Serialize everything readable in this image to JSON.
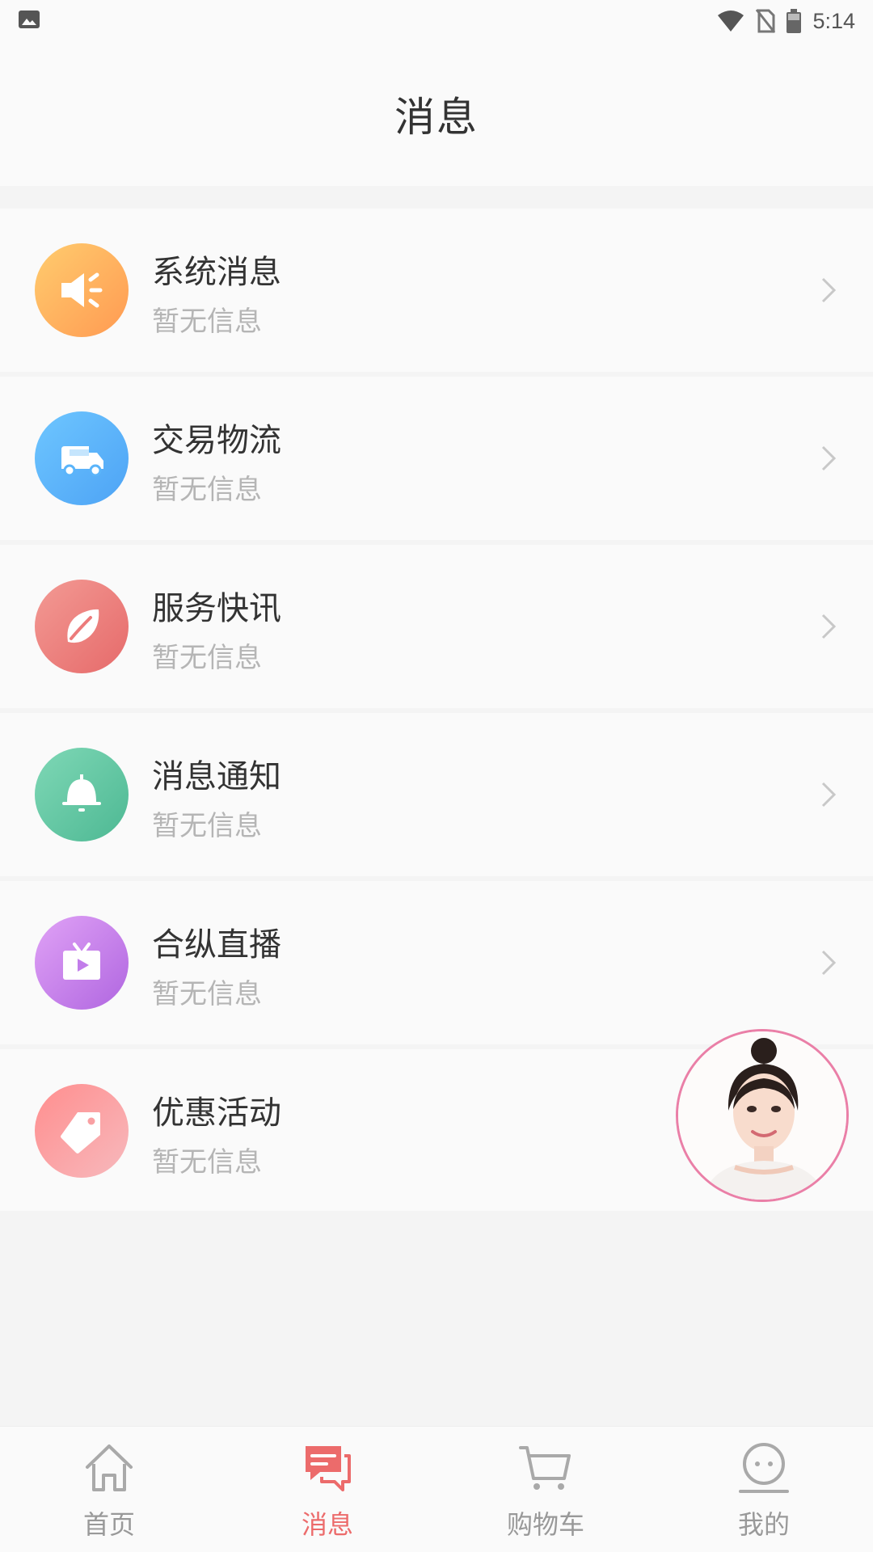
{
  "status_bar": {
    "time": "5:14"
  },
  "header": {
    "title": "消息"
  },
  "messages": [
    {
      "title": "系统消息",
      "subtitle": "暂无信息",
      "icon": "speaker-icon",
      "color": "#ffae5e"
    },
    {
      "title": "交易物流",
      "subtitle": "暂无信息",
      "icon": "truck-icon",
      "color": "#5ab4fa"
    },
    {
      "title": "服务快讯",
      "subtitle": "暂无信息",
      "icon": "leaf-icon",
      "color": "#ec7b7b"
    },
    {
      "title": "消息通知",
      "subtitle": "暂无信息",
      "icon": "bell-icon",
      "color": "#5cc49e"
    },
    {
      "title": "合纵直播",
      "subtitle": "暂无信息",
      "icon": "tv-play-icon",
      "color": "#c27dea"
    },
    {
      "title": "优惠活动",
      "subtitle": "暂无信息",
      "icon": "tag-icon",
      "color": "#f9a0a3"
    }
  ],
  "tabs": [
    {
      "label": "首页",
      "icon": "home-icon",
      "active": false
    },
    {
      "label": "消息",
      "icon": "chat-icon",
      "active": true
    },
    {
      "label": "购物车",
      "icon": "cart-icon",
      "active": false
    },
    {
      "label": "我的",
      "icon": "profile-face-icon",
      "active": false
    }
  ],
  "colors": {
    "accent": "#ec6b6b",
    "inactive": "#999999"
  }
}
